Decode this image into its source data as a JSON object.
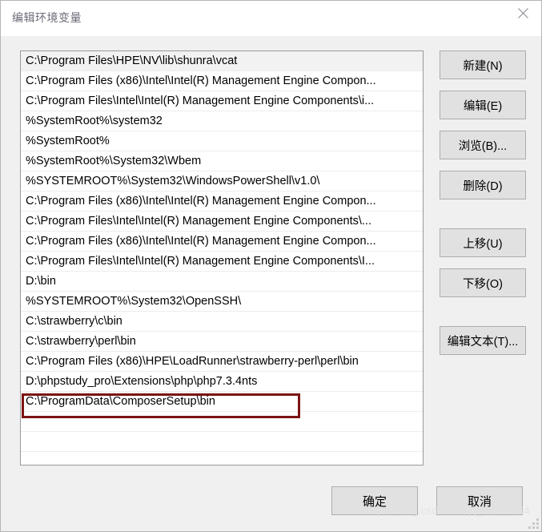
{
  "window": {
    "title": "编辑环境变量",
    "close_icon": "close-icon"
  },
  "path_list": {
    "selected_index": 0,
    "annotated_index": 17,
    "entries": [
      "C:\\Program Files\\HPE\\NV\\lib\\shunra\\vcat",
      "C:\\Program Files (x86)\\Intel\\Intel(R) Management Engine Compon...",
      "C:\\Program Files\\Intel\\Intel(R) Management Engine Components\\i...",
      "%SystemRoot%\\system32",
      "%SystemRoot%",
      "%SystemRoot%\\System32\\Wbem",
      "%SYSTEMROOT%\\System32\\WindowsPowerShell\\v1.0\\",
      "C:\\Program Files (x86)\\Intel\\Intel(R) Management Engine Compon...",
      "C:\\Program Files\\Intel\\Intel(R) Management Engine Components\\...",
      "C:\\Program Files (x86)\\Intel\\Intel(R) Management Engine Compon...",
      "C:\\Program Files\\Intel\\Intel(R) Management Engine Components\\I...",
      "D:\\bin",
      "%SYSTEMROOT%\\System32\\OpenSSH\\",
      "C:\\strawberry\\c\\bin",
      "C:\\strawberry\\perl\\bin",
      "C:\\Program Files (x86)\\HPE\\LoadRunner\\strawberry-perl\\perl\\bin",
      "D:\\phpstudy_pro\\Extensions\\php\\php7.3.4nts",
      "C:\\ProgramData\\ComposerSetup\\bin",
      "",
      "",
      "",
      ""
    ]
  },
  "side_buttons": {
    "new": "新建(N)",
    "edit": "编辑(E)",
    "browse": "浏览(B)...",
    "delete": "删除(D)",
    "move_up": "上移(U)",
    "move_down": "下移(O)",
    "edit_text": "编辑文本(T)..."
  },
  "footer": {
    "ok": "确定",
    "cancel": "取消"
  },
  "watermark": {
    "text": "https://blog.csdn.net/qq_45844654"
  },
  "colors": {
    "dialog_background": "#f0f0f0",
    "button_face": "#e1e1e1",
    "button_border": "#adadad",
    "list_background": "#ffffff",
    "list_border": "#9a9a9a",
    "selected_row": "#f2f2f2",
    "annotation_red": "#7c1414",
    "title_text": "#6b6b78"
  }
}
